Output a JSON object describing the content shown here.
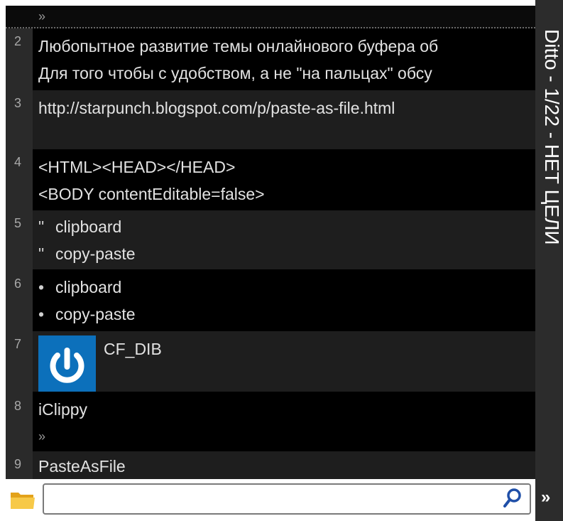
{
  "window": {
    "title": "Ditto - 1/22 - НЕТ ЦЕЛИ",
    "more_glyph": "»"
  },
  "top_strip": {
    "glyph": "»"
  },
  "clips": [
    {
      "index": "2",
      "lines": [
        "Любопытное развитие темы онлайнового буфера об",
        "Для того чтобы с удобством, а не \"на пальцах\" обсу"
      ]
    },
    {
      "index": "3",
      "lines": [
        "http://starpunch.blogspot.com/p/paste-as-file.html"
      ]
    },
    {
      "index": "4",
      "lines": [
        "<HTML><HEAD></HEAD>",
        "<BODY contentEditable=false>"
      ]
    },
    {
      "index": "5",
      "marker": "\"",
      "lines": [
        "clipboard",
        "copy-paste"
      ]
    },
    {
      "index": "6",
      "marker": "•",
      "lines": [
        "clipboard",
        "copy-paste"
      ]
    },
    {
      "index": "7",
      "format_label": "CF_DIB",
      "thumb_icon": "power-icon"
    },
    {
      "index": "8",
      "lines": [
        "iClippy"
      ],
      "chevron": "»"
    },
    {
      "index": "9",
      "lines": [
        "PasteAsFile"
      ]
    }
  ],
  "search": {
    "value": "",
    "placeholder": ""
  },
  "colors": {
    "list_bg": "#000000",
    "alt_row_bg": "#1e1e1e",
    "gutter_bg": "#2a2a2a",
    "titlebar_bg": "#2c2c2c",
    "thumb_bg": "#0c70bb",
    "search_icon": "#1f4fa8"
  }
}
